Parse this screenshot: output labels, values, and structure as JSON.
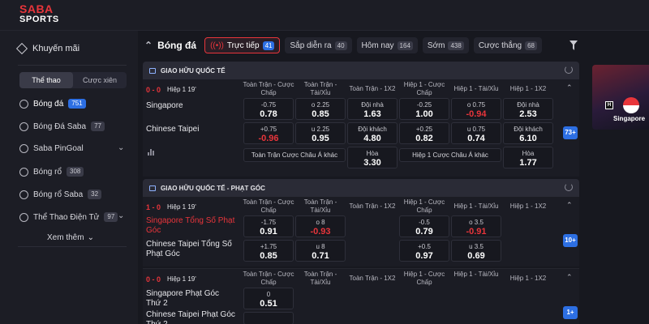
{
  "brand": {
    "line1_a": "SABA",
    "line2": "SPORTS"
  },
  "sidebar": {
    "promo": "Khuyến mãi",
    "segments": [
      "Thể thao",
      "Cược xiên"
    ],
    "items": [
      {
        "label": "Bóng đá",
        "count": "751"
      },
      {
        "label": "Bóng Đá Saba",
        "count": "77"
      },
      {
        "label": "Saba PinGoal",
        "count": ""
      },
      {
        "label": "Bóng rổ",
        "count": "308"
      },
      {
        "label": "Bóng rổ Saba",
        "count": "32"
      },
      {
        "label": "Thể Thao Điện Tử",
        "count": "97"
      }
    ],
    "see_more": "Xem thêm"
  },
  "tabs": {
    "title": "Bóng đá",
    "items": [
      {
        "label": "Trực tiếp",
        "count": "41"
      },
      {
        "label": "Sắp diễn ra",
        "count": "40"
      },
      {
        "label": "Hôm nay",
        "count": "164"
      },
      {
        "label": "Sớm",
        "count": "438"
      },
      {
        "label": "Cược thắng",
        "count": "68"
      }
    ]
  },
  "columns": {
    "ft_handicap": "Toàn Trận - Cược Chấp",
    "ft_ou": "Toàn Trận - Tài/Xỉu",
    "ft_1x2": "Toàn Trận - 1X2",
    "h1_handicap": "Hiệp 1 - Cược Chấp",
    "h1_ou": "Hiệp 1 - Tài/Xỉu",
    "h1_1x2": "Hiệp 1 - 1X2"
  },
  "league1": {
    "name": "GIAO HỮU QUỐC TẾ",
    "score": "0 - 0",
    "time": "Hiệp 1 19'",
    "team1": "Singapore",
    "team2": "Chinese Taipei",
    "row1": [
      {
        "lab": "-0.75",
        "odd": "0.78"
      },
      {
        "lab": "o 2.25",
        "odd": "0.85"
      },
      {
        "lab": "Đội nhà",
        "odd": "1.63"
      },
      {
        "lab": "-0.25",
        "odd": "1.00"
      },
      {
        "lab": "o 0.75",
        "odd": "-0.94"
      },
      {
        "lab": "Đội nhà",
        "odd": "2.53"
      }
    ],
    "row2": [
      {
        "lab": "+0.75",
        "odd": "-0.96"
      },
      {
        "lab": "u 2.25",
        "odd": "0.95"
      },
      {
        "lab": "Đội khách",
        "odd": "4.80"
      },
      {
        "lab": "+0.25",
        "odd": "0.82"
      },
      {
        "lab": "u 0.75",
        "odd": "0.74"
      },
      {
        "lab": "Đội khách",
        "odd": "6.10"
      }
    ],
    "extra_left": "Toàn Trận Cược Châu Á khác",
    "draw_ft": {
      "lab": "Hòa",
      "odd": "3.30"
    },
    "extra_right": "Hiệp 1 Cược Châu Á khác",
    "draw_h1": {
      "lab": "Hòa",
      "odd": "1.77"
    },
    "more": "73+"
  },
  "league2": {
    "name": "GIAO HỮU QUỐC TẾ - PHẠT GÓC",
    "score": "1 - 0",
    "time": "Hiệp 1 19'",
    "team1": "Singapore Tổng Số Phạt Góc",
    "team2": "Chinese Taipei Tổng Số Phạt Góc",
    "row1": [
      {
        "lab": "-1.75",
        "odd": "0.91"
      },
      {
        "lab": "o 8",
        "odd": "-0.93"
      },
      {
        "lab": "-0.5",
        "odd": "0.79"
      },
      {
        "lab": "o 3.5",
        "odd": "-0.91"
      }
    ],
    "row2": [
      {
        "lab": "+1.75",
        "odd": "0.85"
      },
      {
        "lab": "u 8",
        "odd": "0.71"
      },
      {
        "lab": "+0.5",
        "odd": "0.97"
      },
      {
        "lab": "u 3.5",
        "odd": "0.69"
      }
    ],
    "more": "10+"
  },
  "league3": {
    "score": "0 - 0",
    "time": "Hiệp 1 19'",
    "team1": "Singapore Phạt Góc Thứ 2",
    "team2": "Chinese Taipei Phạt Góc Thứ 2",
    "row1": [
      {
        "lab": "0",
        "odd": "0.51"
      }
    ],
    "more": "1+"
  },
  "video": {
    "team": "Singapore",
    "badge": "H"
  },
  "colors": {
    "accent": "#2d6fe3",
    "negative": "#e8353b",
    "bg": "#17181f"
  }
}
